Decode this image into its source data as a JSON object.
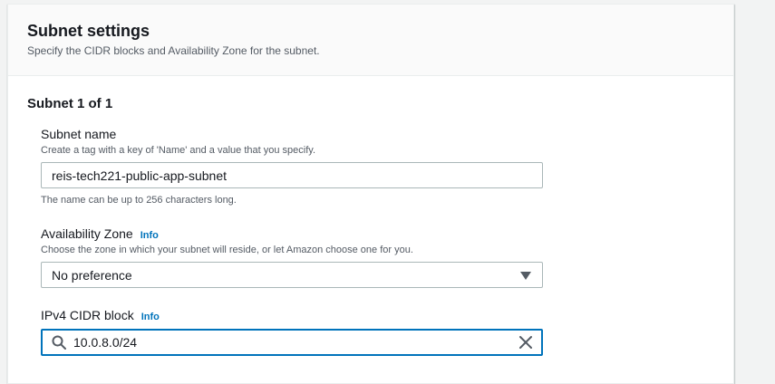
{
  "panel": {
    "title": "Subnet settings",
    "description": "Specify the CIDR blocks and Availability Zone for the subnet."
  },
  "subnet": {
    "heading": "Subnet 1 of 1",
    "name_field": {
      "label": "Subnet name",
      "description": "Create a tag with a key of 'Name' and a value that you specify.",
      "value": "reis-tech221-public-app-subnet",
      "constraint": "The name can be up to 256 characters long."
    },
    "az_field": {
      "label": "Availability Zone",
      "info": "Info",
      "description": "Choose the zone in which your subnet will reside, or let Amazon choose one for you.",
      "selected": "No preference"
    },
    "cidr_field": {
      "label": "IPv4 CIDR block",
      "info": "Info",
      "value": "10.0.8.0/24"
    }
  },
  "icons": {
    "search": "search-icon",
    "clear": "close-icon",
    "dropdown": "caret-down-icon"
  },
  "colors": {
    "accent": "#0073bb",
    "text": "#16191f",
    "muted": "#545b64",
    "border": "#aab7b8"
  }
}
